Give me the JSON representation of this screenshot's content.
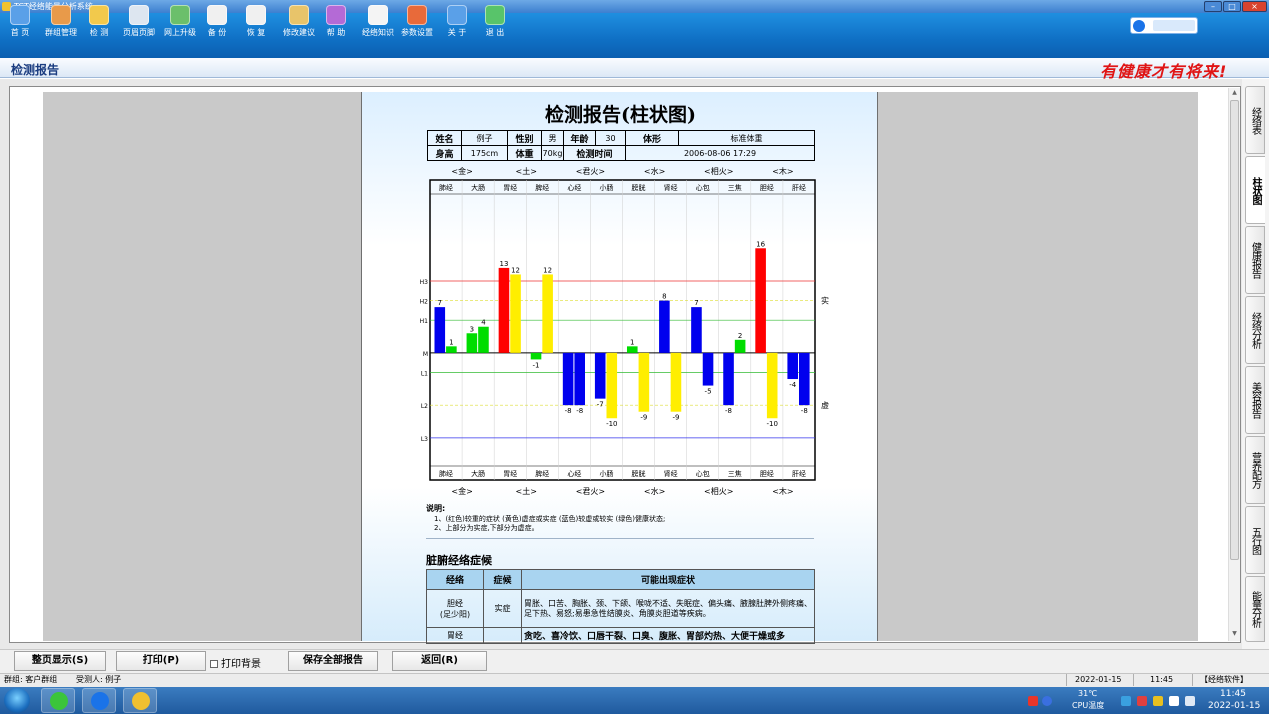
{
  "window": {
    "title": "TCT经络能量分析系统",
    "btn_min": "–",
    "btn_max": "□",
    "btn_close": "×"
  },
  "toolbar": {
    "items": [
      {
        "label": "首 页",
        "icon": "home-icon",
        "color": "#5aa0e8"
      },
      {
        "label": "群组管理",
        "icon": "group-icon",
        "color": "#e89a4a"
      },
      {
        "label": "检 测",
        "icon": "hand-icon",
        "color": "#f2c94c"
      },
      {
        "label": "页眉页脚",
        "icon": "header-footer-icon",
        "color": "#dde6f0"
      },
      {
        "label": "网上升级",
        "icon": "upgrade-icon",
        "color": "#6bbf6b"
      },
      {
        "label": "备 份",
        "icon": "backup-icon",
        "color": "#f0f0f0"
      },
      {
        "label": "恢 复",
        "icon": "restore-icon",
        "color": "#f0f0f0"
      },
      {
        "label": "修改建议",
        "icon": "suggestion-icon",
        "color": "#e8c46a"
      },
      {
        "label": "帮 助",
        "icon": "help-icon",
        "color": "#b46ad6"
      },
      {
        "label": "经络知识",
        "icon": "knowledge-icon",
        "color": "#f4f4f4"
      },
      {
        "label": "参数设置",
        "icon": "settings-icon",
        "color": "#e86a3a"
      },
      {
        "label": "关 于",
        "icon": "about-icon",
        "color": "#5aa0e8"
      },
      {
        "label": "退 出",
        "icon": "exit-icon",
        "color": "#58c46a"
      }
    ]
  },
  "search": {
    "placeholder": ""
  },
  "header": {
    "page_title": "检测报告",
    "slogan": "有健康才有将来!"
  },
  "report": {
    "title": "检测报告(柱状图)",
    "info": {
      "name_label": "姓名",
      "name": "例子",
      "gender_label": "性别",
      "gender": "男",
      "age_label": "年龄",
      "age": "30",
      "body_label": "体形",
      "body": "标准体重",
      "height_label": "身高",
      "height": "175cm",
      "weight_label": "体重",
      "weight": "70kg",
      "time_label": "检测时间",
      "time": "2006-08-06 17:29"
    },
    "notes_title": "说明:",
    "notes": [
      "1、(红色)较重的症状 (黄色)虚症或实症 (蓝色)较虚或较实 (绿色)健康状态;",
      "2、上部分为实症,下部分为虚症。"
    ],
    "section_title": "脏腑经络症候",
    "symptom_headers": [
      "经络",
      "症候",
      "可能出现症状"
    ],
    "symptom_rows": [
      {
        "meridian": "胆经",
        "meridian_sub": "(足少阳)",
        "type": "实症",
        "desc": "胃胀、口苦、胸胀、颈、下颌、喉咙不适、失眠症、偏头痛、腋腺肚脾外侧疼痛、足下热、易怒;易患急性结膜炎、角膜炎胆道等疾病。"
      },
      {
        "meridian": "胃经",
        "meridian_sub": "",
        "type": "",
        "desc": "贪吃、喜冷饮、口唇干裂、口臭、腹胀、胃部灼热、大便干燥或多"
      }
    ]
  },
  "chart_data": {
    "type": "bar",
    "title": "",
    "categories": [
      "肺经",
      "大肠",
      "胃经",
      "脾经",
      "心经",
      "小肠",
      "膀胱",
      "肾经",
      "心包",
      "三焦",
      "胆经",
      "肝经"
    ],
    "element_groups": [
      "<金>",
      "<土>",
      "<君火>",
      "<水>",
      "<相火>",
      "<木>"
    ],
    "series": [
      {
        "values": [
          7,
          3,
          13,
          -1,
          -8,
          -7,
          1,
          8,
          7,
          -8,
          16,
          -4
        ],
        "colors": [
          "#0000ee",
          "#00dd00",
          "#ff0000",
          "#00dd00",
          "#0000ee",
          "#0000ee",
          "#00dd00",
          "#0000ee",
          "#0000ee",
          "#0000ee",
          "#ff0000",
          "#0000ee"
        ]
      },
      {
        "values": [
          1,
          4,
          12,
          12,
          -8,
          -10,
          -9,
          -9,
          -5,
          2,
          -10,
          -8
        ],
        "colors": [
          "#00dd00",
          "#00dd00",
          "#ffee00",
          "#ffee00",
          "#0000ee",
          "#ffee00",
          "#ffee00",
          "#ffee00",
          "#0000ee",
          "#00dd00",
          "#ffee00",
          "#0000ee"
        ]
      }
    ],
    "ylim": [
      -17,
      24
    ],
    "ref_lines": [
      {
        "label": "H3",
        "value": 11,
        "color": "#ee3333"
      },
      {
        "label": "H2",
        "value": 8,
        "color": "#dddd33"
      },
      {
        "label": "H1",
        "value": 5,
        "color": "#33bb33"
      },
      {
        "label": "M",
        "value": 0,
        "color": "#000000"
      },
      {
        "label": "L1",
        "value": -3,
        "color": "#33bb33"
      },
      {
        "label": "L2",
        "value": -8,
        "color": "#dddd33"
      },
      {
        "label": "L3",
        "value": -13,
        "color": "#3333ee"
      }
    ],
    "side_labels": {
      "top": "实",
      "bottom": "虚"
    }
  },
  "side_tabs": [
    {
      "label": "经络表",
      "active": false
    },
    {
      "label": "柱状图",
      "active": true
    },
    {
      "label": "健康报告",
      "active": false
    },
    {
      "label": "经络分析",
      "active": false
    },
    {
      "label": "美容报告",
      "active": false
    },
    {
      "label": "营养配方",
      "active": false
    },
    {
      "label": "五行图",
      "active": false
    },
    {
      "label": "能量分析",
      "active": false
    }
  ],
  "buttons": {
    "fullpage": "整页显示(S)",
    "print": "打印(P)",
    "print_bg": "打印背景",
    "save_all": "保存全部报告",
    "back": "返回(R)"
  },
  "status": {
    "group": "群组: 客户群组",
    "tested": "受测人: 例子",
    "date": "2022-01-15",
    "time": "11:45",
    "software": "【经络软件】"
  },
  "taskbar": {
    "temp": "31℃",
    "cpu": "CPU温度",
    "clock_time": "11:45",
    "clock_date": "2022-01-15"
  }
}
